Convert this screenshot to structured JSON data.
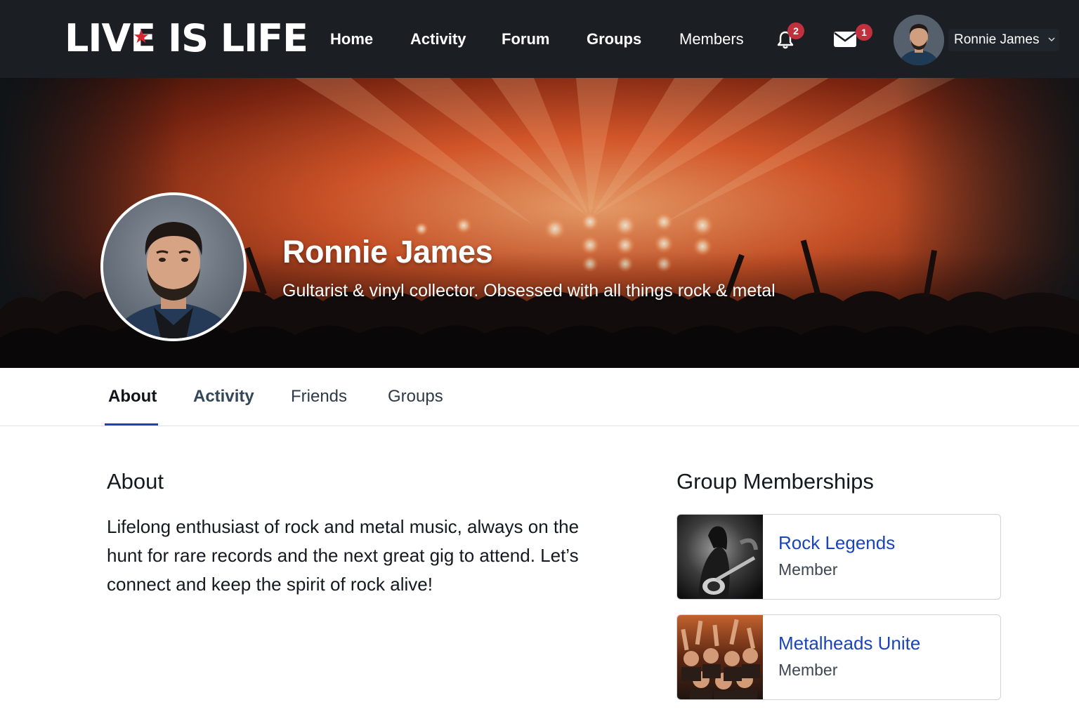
{
  "navbar": {
    "logo": "LIVE IS LIFE",
    "links": [
      {
        "label": "Home"
      },
      {
        "label": "Activity"
      },
      {
        "label": "Forum"
      },
      {
        "label": "Groups"
      },
      {
        "label": "Members"
      }
    ],
    "notifications": {
      "icon": "bell-icon",
      "count": "2"
    },
    "messages": {
      "icon": "envelope-icon",
      "count": "1"
    },
    "user": {
      "name": "Ronnie James",
      "icon": "chevron-down-icon"
    }
  },
  "profile": {
    "name": "Ronnie James",
    "bio": "Gultarist & vinyl collector. Obsessed with all things rock & metal"
  },
  "tabs": [
    {
      "label": "About",
      "active": true
    },
    {
      "label": "Activity",
      "active": false
    },
    {
      "label": "Friends",
      "active": false
    },
    {
      "label": "Groups",
      "active": false
    }
  ],
  "about": {
    "heading": "About",
    "text": "Lifelong enthusiast of rock and metal music, always on the hunt for rare records and the next great gig to attend. Let’s connect and keep the spirit of rock alive!"
  },
  "groups": {
    "heading": "Group Memberships",
    "items": [
      {
        "name": "Rock Legends",
        "role": "Member"
      },
      {
        "name": "Metalheads Unite",
        "role": "Member"
      }
    ]
  },
  "colors": {
    "navbar_bg": "#1b1f24",
    "accent_blue": "#1a44b8",
    "badge_red": "#c0313d",
    "logo_star_red": "#d8262e"
  }
}
